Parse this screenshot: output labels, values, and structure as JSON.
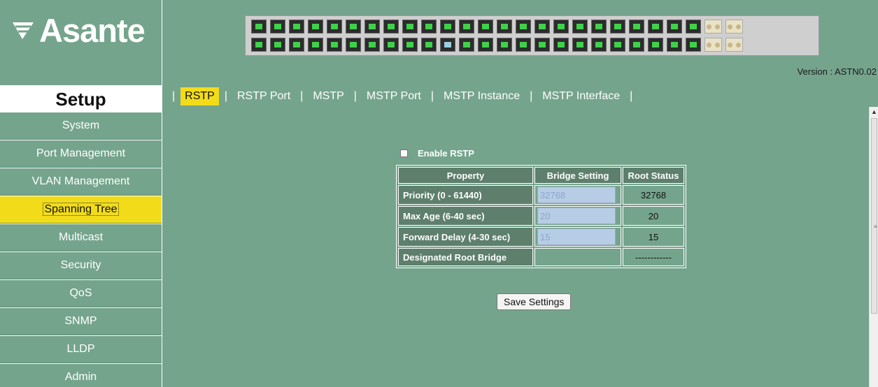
{
  "brand": {
    "logo_text": "Asante"
  },
  "header": {
    "version_label": "Version :",
    "version_value": "ASTN0.02"
  },
  "sidebar": {
    "title": "Setup",
    "items": [
      {
        "label": "System"
      },
      {
        "label": "Port Management"
      },
      {
        "label": "VLAN Management"
      },
      {
        "label": "Spanning Tree",
        "active": true
      },
      {
        "label": "Multicast"
      },
      {
        "label": "Security"
      },
      {
        "label": "QoS"
      },
      {
        "label": "SNMP"
      },
      {
        "label": "LLDP"
      },
      {
        "label": "Admin"
      }
    ]
  },
  "tabs": [
    {
      "label": "RSTP",
      "active": true
    },
    {
      "label": "RSTP Port"
    },
    {
      "label": "MSTP"
    },
    {
      "label": "MSTP Port"
    },
    {
      "label": "MSTP Instance"
    },
    {
      "label": "MSTP Interface"
    }
  ],
  "form": {
    "enable_label": "Enable RSTP",
    "enable_checked": false,
    "table": {
      "headers": [
        "Property",
        "Bridge Setting",
        "Root Status"
      ],
      "rows": [
        {
          "property": "Priority (0 - 61440)",
          "bridge_setting": "32768",
          "root_status": "32768"
        },
        {
          "property": "Max Age (6-40 sec)",
          "bridge_setting": "20",
          "root_status": "20"
        },
        {
          "property": "Forward Delay (4-30 sec)",
          "bridge_setting": "15",
          "root_status": "15"
        },
        {
          "property": "Designated Root Bridge",
          "bridge_setting": "",
          "root_status": "------------"
        }
      ]
    },
    "save_label": "Save Settings"
  },
  "colors": {
    "panel_green": "#75a48c",
    "header_cell": "#5d7f6c",
    "active_yellow": "#f2dc1a",
    "input_blue": "#b7cde6"
  }
}
